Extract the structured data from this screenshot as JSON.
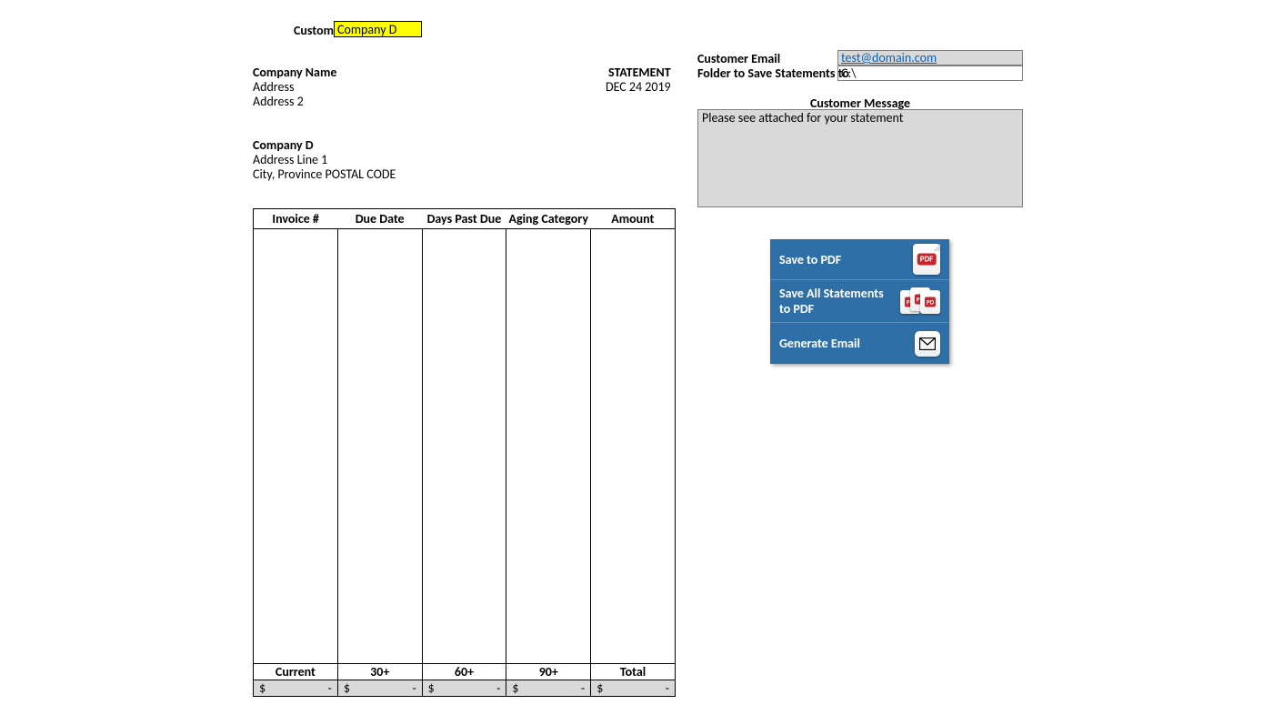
{
  "header": {
    "customer_label": "Customer",
    "customer_value": "Company D"
  },
  "sender": {
    "company_name": "Company Name",
    "address1": "Address",
    "address2": "Address 2"
  },
  "statement": {
    "title": "STATEMENT",
    "date": "DEC 24 2019"
  },
  "recipient": {
    "name": "Company D",
    "address1": "Address Line 1",
    "city_prov_postal": "City, Province POSTAL CODE"
  },
  "invoice_headers": [
    "Invoice #",
    "Due Date",
    "Days Past Due",
    "Aging Category",
    "Amount"
  ],
  "summary_headers": [
    "Current",
    "30+",
    "60+",
    "90+",
    "Total"
  ],
  "summary_values": {
    "currency": "$",
    "current": "-",
    "d30": "-",
    "d60": "-",
    "d90": "-",
    "total": "-"
  },
  "right": {
    "email_label": "Customer Email",
    "email_value": "test@domain.com",
    "folder_label": "Folder to Save Statements to",
    "folder_value": "C:\\",
    "message_label": "Customer Message",
    "message_value": "Please see attached for your statement"
  },
  "buttons": {
    "save_pdf": "Save to PDF",
    "save_all_pdf": "Save All Statements to PDF",
    "generate_email": "Generate Email"
  }
}
